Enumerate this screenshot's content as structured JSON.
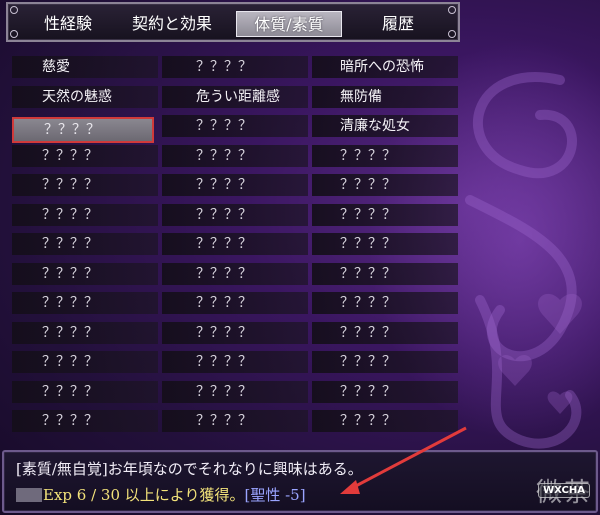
{
  "tabs": [
    {
      "label": "性経験",
      "active": false
    },
    {
      "label": "契約と効果",
      "active": false
    },
    {
      "label": "体質/素質",
      "active": true
    },
    {
      "label": "履歴",
      "active": false
    }
  ],
  "traits": {
    "columns": [
      [
        "慈愛",
        "天然の魅惑",
        "？？？？",
        "？？？？",
        "？？？？",
        "？？？？",
        "？？？？",
        "？？？？",
        "？？？？",
        "？？？？",
        "？？？？",
        "？？？？",
        "？？？？"
      ],
      [
        "？？？？",
        "危うい距離感",
        "？？？？",
        "？？？？",
        "？？？？",
        "？？？？",
        "？？？？",
        "？？？？",
        "？？？？",
        "？？？？",
        "？？？？",
        "？？？？",
        "？？？？"
      ],
      [
        "暗所への恐怖",
        "無防備",
        "清廉な処女",
        "？？？？",
        "？？？？",
        "？？？？",
        "？？？？",
        "？？？？",
        "？？？？",
        "？？？？",
        "？？？？",
        "？？？？",
        "？？？？"
      ]
    ],
    "selected": {
      "col": 0,
      "row": 2
    }
  },
  "message": {
    "line1": "[素質/無自覚]お年頃なのでそれなりに興味はある。",
    "exp_text": "Exp 6 / 30 以上により獲得。",
    "trait_tag": "[聖性 -5]"
  },
  "watermark": {
    "text": "微茶",
    "badge": "WXCHA"
  },
  "colors": {
    "selected_border": "#d03a3a",
    "exp_yellow": "#f2e27a",
    "tag_blue": "#9aa4ff",
    "arrow_red": "#e23b3b"
  }
}
